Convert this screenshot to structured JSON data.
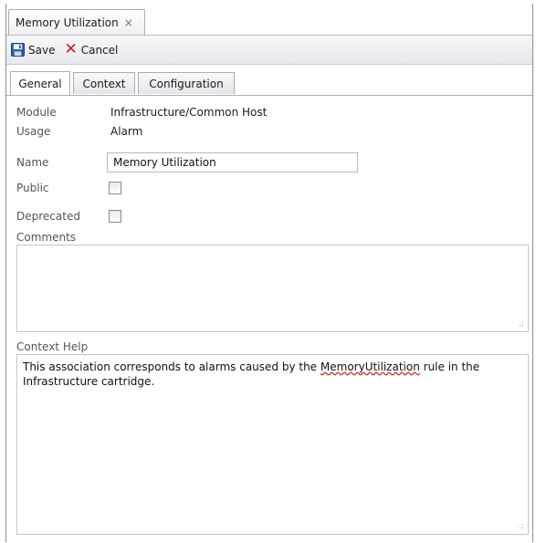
{
  "doc_tab": {
    "title": "Memory Utilization",
    "close_glyph": "×"
  },
  "toolbar": {
    "save_label": "Save",
    "cancel_label": "Cancel",
    "cancel_glyph": "✕"
  },
  "tabs": [
    {
      "label": "General",
      "active": true
    },
    {
      "label": "Context",
      "active": false
    },
    {
      "label": "Configuration",
      "active": false
    }
  ],
  "fields": {
    "module": {
      "label": "Module",
      "value": "Infrastructure/Common Host"
    },
    "usage": {
      "label": "Usage",
      "value": "Alarm"
    },
    "name": {
      "label": "Name",
      "value": "Memory Utilization"
    },
    "public": {
      "label": "Public",
      "checked": false
    },
    "deprecated": {
      "label": "Deprecated",
      "checked": false
    },
    "comments": {
      "label": "Comments",
      "value": ""
    },
    "context_help": {
      "label": "Context Help",
      "text_before": "This association corresponds to alarms caused by the ",
      "text_misspelled": "MemoryUtilization",
      "text_after": " rule in the Infrastructure cartridge."
    }
  },
  "colors": {
    "cancel_red": "#d21a1a",
    "save_blue": "#2b5fa8",
    "spellcheck_red": "#d02020"
  }
}
